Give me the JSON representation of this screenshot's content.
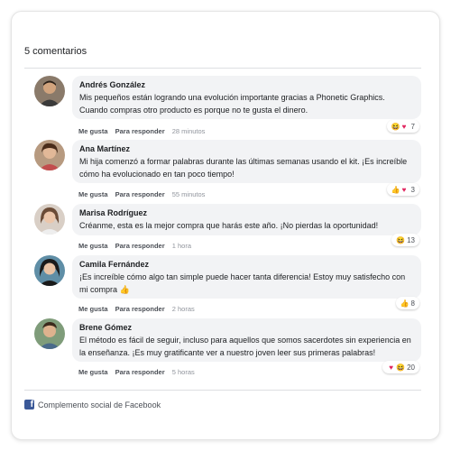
{
  "header": {
    "count_label": "5 comentarios"
  },
  "comments": [
    {
      "name": "Andrés González",
      "text": "Mis pequeños están logrando una evolución importante gracias a Phonetic Graphics. Cuando compras otro producto es porque no te gusta el dinero.",
      "like": "Me gusta",
      "reply": "Para responder",
      "time": "28 minutos",
      "reactions": [
        "haha-icon",
        "love-icon"
      ],
      "reaction_count": "7"
    },
    {
      "name": "Ana Martínez",
      "text": "Mi hija comenzó a formar palabras durante las últimas semanas usando el kit. ¡Es increíble cómo ha evolucionado en tan poco tiempo!",
      "like": "Me gusta",
      "reply": "Para responder",
      "time": "55 minutos",
      "reactions": [
        "like-icon",
        "love-icon"
      ],
      "reaction_count": "3"
    },
    {
      "name": "Marisa Rodríguez",
      "text": "Créanme, esta es la mejor compra que harás este año. ¡No pierdas la oportunidad!",
      "like": "Me gusta",
      "reply": "Para responder",
      "time": "1 hora",
      "reactions": [
        "haha-icon"
      ],
      "reaction_count": "13"
    },
    {
      "name": "Camila Fernández",
      "text": "¡Es increíble cómo algo tan simple puede hacer tanta diferencia! Estoy muy satisfecho con mi compra 👍",
      "like": "Me gusta",
      "reply": "Para responder",
      "time": "2 horas",
      "reactions": [
        "like-icon"
      ],
      "reaction_count": "8"
    },
    {
      "name": "Brene Gómez",
      "text": "El método es fácil de seguir, incluso para aquellos que somos sacerdotes sin experiencia en la enseñanza. ¡Es muy gratificante ver a nuestro joven leer sus primeras palabras!",
      "like": "Me gusta",
      "reply": "Para responder",
      "time": "5 horas",
      "reactions": [
        "love-icon",
        "haha-icon"
      ],
      "reaction_count": "20"
    }
  ],
  "footer": {
    "label": "Complemento social de Facebook"
  },
  "colors": {
    "facebook_blue": "#3b5998",
    "bubble_bg": "#f2f3f5",
    "love_red": "#f33e58"
  }
}
